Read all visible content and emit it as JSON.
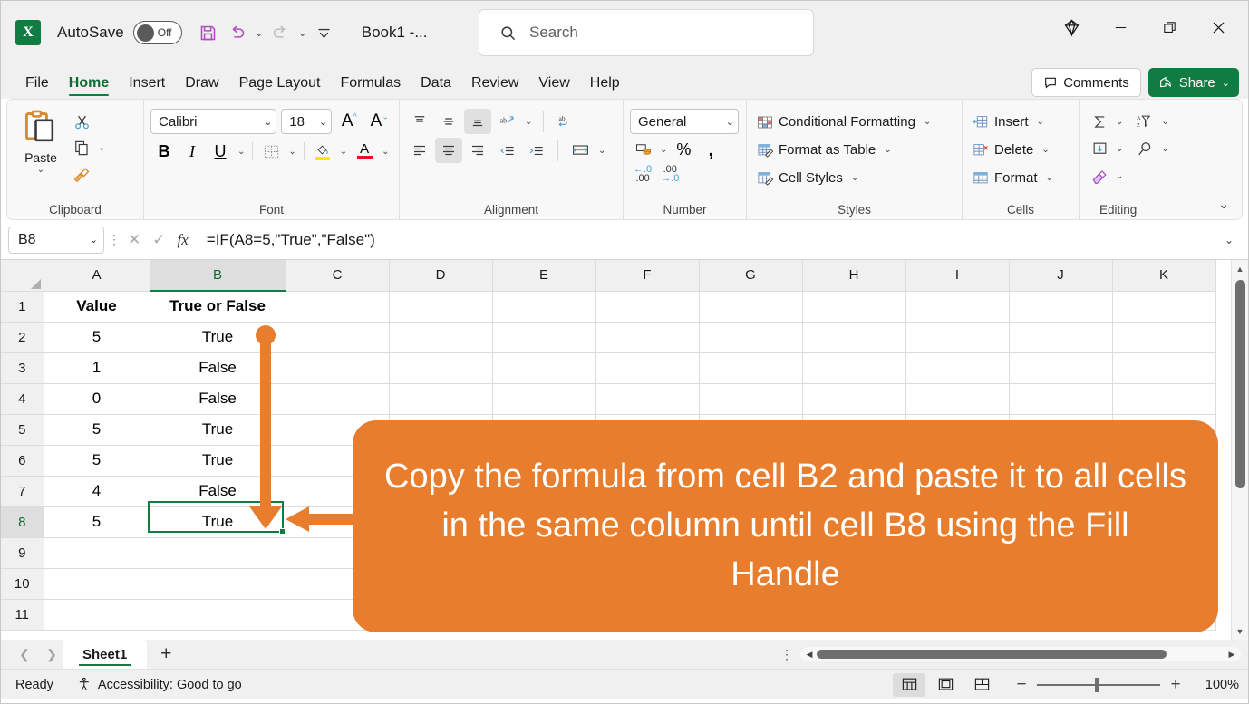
{
  "titlebar": {
    "app_icon": "excel-logo",
    "autosave_label": "AutoSave",
    "autosave_state": "Off",
    "document_title": "Book1  -...",
    "quick_access": [
      "save-icon",
      "undo-icon",
      "redo-icon",
      "customize-qat-icon"
    ],
    "search_placeholder": "Search",
    "copilot_icon": "diamond-icon",
    "minimize": "minimize-icon",
    "restore": "restore-icon",
    "close": "close-icon"
  },
  "ribbon_tabs": {
    "tabs": [
      {
        "label": "File",
        "active": false
      },
      {
        "label": "Home",
        "active": true
      },
      {
        "label": "Insert",
        "active": false
      },
      {
        "label": "Draw",
        "active": false
      },
      {
        "label": "Page Layout",
        "active": false
      },
      {
        "label": "Formulas",
        "active": false
      },
      {
        "label": "Data",
        "active": false
      },
      {
        "label": "Review",
        "active": false
      },
      {
        "label": "View",
        "active": false
      },
      {
        "label": "Help",
        "active": false
      }
    ],
    "comments_label": "Comments",
    "share_label": "Share"
  },
  "ribbon": {
    "groups": [
      {
        "name": "Clipboard",
        "label": "Clipboard"
      },
      {
        "name": "Font",
        "label": "Font"
      },
      {
        "name": "Alignment",
        "label": "Alignment"
      },
      {
        "name": "Number",
        "label": "Number"
      },
      {
        "name": "Styles",
        "label": "Styles"
      },
      {
        "name": "Cells",
        "label": "Cells"
      },
      {
        "name": "Editing",
        "label": "Editing"
      }
    ],
    "clipboard": {
      "paste_label": "Paste"
    },
    "font": {
      "family": "Calibri",
      "size": "18"
    },
    "number": {
      "format": "General"
    },
    "styles": {
      "conditional_formatting": "Conditional Formatting",
      "format_as_table": "Format as Table",
      "cell_styles": "Cell Styles"
    },
    "cells": {
      "insert": "Insert",
      "delete": "Delete",
      "format": "Format"
    },
    "group_labels": {
      "clipboard": "Clipboard",
      "font": "Font",
      "alignment": "Alignment",
      "number": "Number",
      "styles": "Styles",
      "cells": "Cells",
      "editing": "Editing"
    }
  },
  "formula_bar": {
    "name_box": "B8",
    "formula": "=IF(A8=5,\"True\",\"False\")",
    "cancel_icon": "x-icon",
    "enter_icon": "check-icon",
    "fx_icon": "fx-icon"
  },
  "grid": {
    "columns": [
      "A",
      "B",
      "C",
      "D",
      "E",
      "F",
      "G",
      "H",
      "I",
      "J",
      "K"
    ],
    "selected_column": "B",
    "selected_row": "8",
    "selected_cell": "B8",
    "rows": [
      {
        "num": "1",
        "A": "Value",
        "B": "True or False",
        "header": true
      },
      {
        "num": "2",
        "A": "5",
        "B": "True"
      },
      {
        "num": "3",
        "A": "1",
        "B": "False"
      },
      {
        "num": "4",
        "A": "0",
        "B": "False"
      },
      {
        "num": "5",
        "A": "5",
        "B": "True"
      },
      {
        "num": "6",
        "A": "5",
        "B": "True"
      },
      {
        "num": "7",
        "A": "4",
        "B": "False"
      },
      {
        "num": "8",
        "A": "5",
        "B": "True"
      },
      {
        "num": "9",
        "A": "",
        "B": ""
      },
      {
        "num": "10",
        "A": "",
        "B": ""
      },
      {
        "num": "11",
        "A": "",
        "B": ""
      }
    ]
  },
  "annotation": {
    "color": "#e87d2e",
    "callout_text": "Copy the formula from cell B2 and paste it to all cells in the same column until cell B8 using  the Fill Handle"
  },
  "sheet_bar": {
    "prev_icon": "chevron-left-icon",
    "next_icon": "chevron-right-icon",
    "sheets": [
      "Sheet1"
    ],
    "active_sheet": "Sheet1",
    "add_sheet_label": "+"
  },
  "status_bar": {
    "status": "Ready",
    "accessibility": "Accessibility: Good to go",
    "views": [
      {
        "name": "normal-view",
        "active": true
      },
      {
        "name": "page-layout-view",
        "active": false
      },
      {
        "name": "page-break-view",
        "active": false
      }
    ],
    "zoom_out": "−",
    "zoom_in": "+",
    "zoom_level": "100%"
  }
}
